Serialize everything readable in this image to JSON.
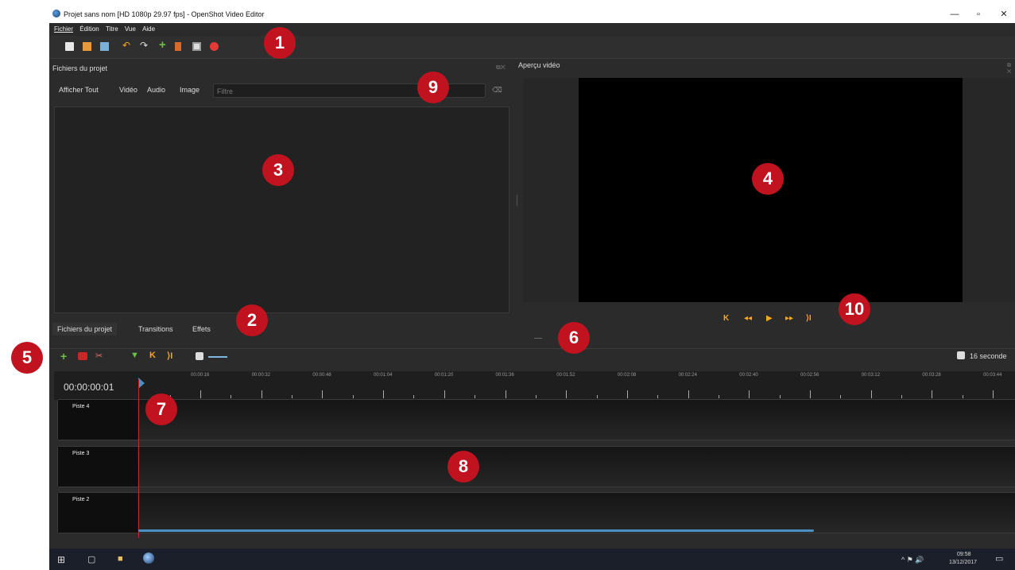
{
  "window": {
    "title": "Projet sans nom [HD 1080p 29.97 fps] - OpenShot Video Editor",
    "controls": {
      "minimize": "—",
      "maximize": "▫",
      "close": "✕"
    }
  },
  "menu": [
    "Fichier",
    "Édition",
    "Titre",
    "Vue",
    "Aide"
  ],
  "toolbar_icons": [
    "new-project-icon",
    "open-project-icon",
    "save-project-icon",
    "undo-icon",
    "redo-icon",
    "import-files-icon",
    "profile-icon",
    "fullscreen-icon",
    "export-video-icon"
  ],
  "files_panel": {
    "title": "Fichiers du projet",
    "filter_tabs": [
      "Afficher Tout",
      "Vidéo",
      "Audio",
      "Image"
    ],
    "filter_placeholder": "Filtre",
    "clear_icon": "⌫"
  },
  "bottom_tabs": [
    "Fichiers du projet",
    "Transitions",
    "Effets"
  ],
  "preview": {
    "title": "Aperçu vidéo",
    "panel_icons": "⧉ ✕"
  },
  "player_controls": [
    "K",
    "◂◂",
    "▶",
    "▸▸",
    "⟩I"
  ],
  "timeline": {
    "timecode": "00:00:00:01",
    "zoom_label": "16 seconde",
    "ruler_labels": [
      "00:00:16",
      "00:00:32",
      "00:00:48",
      "00:01:04",
      "00:01:20",
      "00:01:36",
      "00:01:52",
      "00:02:08",
      "00:02:24",
      "00:02:40",
      "00:02:56",
      "00:03:12",
      "00:03:28",
      "00:03:44"
    ],
    "tracks": [
      "Piste 4",
      "Piste 3",
      "Piste 2"
    ]
  },
  "badges": [
    "1",
    "2",
    "3",
    "4",
    "5",
    "6",
    "7",
    "8",
    "9",
    "10"
  ],
  "taskbar": {
    "time": "09:58",
    "date": "13/12/2017",
    "tray": "^ ⚑ 🔊"
  },
  "colors": {
    "accent_orange": "#f5a623",
    "badge_red": "#c1121f",
    "playhead": "#c62828",
    "scroll_blue": "#4a90c2"
  }
}
